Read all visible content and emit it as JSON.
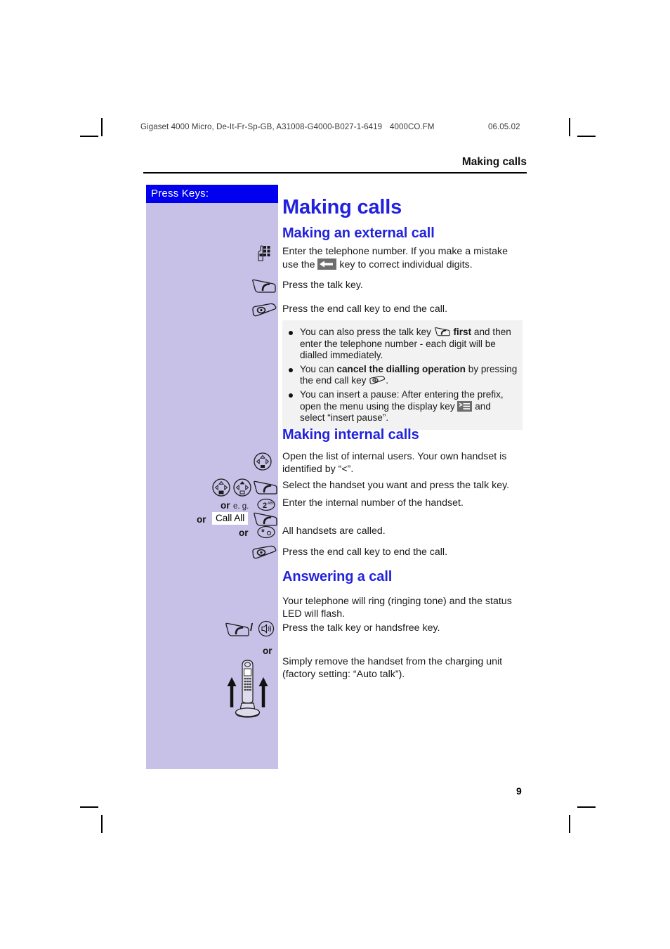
{
  "header": {
    "document_line": "Gigaset 4000 Micro, De-It-Fr-Sp-GB, A31008-G4000-B027-1-6419",
    "file_name": "4000CO.FM",
    "date": "06.05.02",
    "running_head": "Making calls"
  },
  "sidebar": {
    "title": "Press Keys:",
    "background_color": "#c7c1e7",
    "title_background_color": "#0000ee",
    "icons": [
      {
        "name": "keypad-key",
        "row": "enter-number"
      },
      {
        "name": "talk-key",
        "row": "press-talk"
      },
      {
        "name": "end-call-key",
        "row": "end-call"
      },
      {
        "name": "nav-key-down",
        "row": "open-internal-list"
      },
      {
        "name": "nav-key-select",
        "row": "select-handset"
      },
      {
        "name": "nav-key-up",
        "row": "select-handset"
      },
      {
        "name": "talk-key",
        "row": "select-handset"
      },
      {
        "name": "digit-key-2",
        "row": "enter-internal-number",
        "label": "2"
      },
      {
        "name": "call-all-display-key",
        "row": "call-all",
        "label": "Call All"
      },
      {
        "name": "talk-key",
        "row": "call-all"
      },
      {
        "name": "star-key",
        "row": "all-handsets-called"
      },
      {
        "name": "end-call-key",
        "row": "end-call-internal"
      },
      {
        "name": "talk-key",
        "row": "answer-call"
      },
      {
        "name": "handsfree-key",
        "row": "answer-call"
      },
      {
        "name": "handset-charging-unit",
        "row": "remove-handset"
      }
    ],
    "or_labels": [
      "or",
      "or",
      "or",
      "or"
    ],
    "eg_label": "e. g.",
    "call_all_label": "Call All",
    "separator_slash": "/"
  },
  "main": {
    "title": "Making calls",
    "accent_color": "#2222dd",
    "sections": [
      {
        "heading": "Making an external call",
        "steps": [
          {
            "icon": "keypad-key",
            "text_before": "Enter the telephone number. If you make a mistake use the ",
            "inline_icon": "correction-key",
            "text_after": " key to correct individual digits."
          },
          {
            "icon": "talk-key",
            "text": "Press the talk key."
          },
          {
            "icon": "end-call-key",
            "text": "Press the end call key to end the call."
          }
        ],
        "note_box": {
          "background_color": "#f2f2f2",
          "items": [
            {
              "parts": [
                {
                  "type": "text",
                  "value": "You can also press the talk key "
                },
                {
                  "type": "icon",
                  "value": "talk-key"
                },
                {
                  "type": "bold",
                  "value": " first"
                },
                {
                  "type": "text",
                  "value": " and then enter the telephone number - each digit will be dialled immediately."
                }
              ]
            },
            {
              "parts": [
                {
                  "type": "text",
                  "value": "You can "
                },
                {
                  "type": "bold",
                  "value": "cancel the dialling operation"
                },
                {
                  "type": "text",
                  "value": " by pressing the end call key "
                },
                {
                  "type": "icon",
                  "value": "end-call-key"
                },
                {
                  "type": "text",
                  "value": "."
                }
              ]
            },
            {
              "parts": [
                {
                  "type": "text",
                  "value": "You can insert a pause: After entering the prefix, open the menu using the display key "
                },
                {
                  "type": "icon",
                  "value": "display-key"
                },
                {
                  "type": "text",
                  "value": " and select “insert pause”."
                }
              ]
            }
          ]
        }
      },
      {
        "heading": "Making internal calls",
        "steps": [
          {
            "icon": "nav-key-down",
            "text": "Open the list of internal users. Your own handset is identified by “<”."
          },
          {
            "icon": "nav-keys-and-talk",
            "text": "Select the handset you want and press the talk key."
          },
          {
            "icon": "digit-key-2",
            "text": "Enter the internal number of the handset."
          },
          {
            "icon": "call-all-and-talk",
            "text": ""
          },
          {
            "icon": "star-key",
            "text": "All handsets are called."
          },
          {
            "icon": "end-call-key",
            "text": "Press the end call key to end the call."
          }
        ]
      },
      {
        "heading": "Answering a call",
        "steps": [
          {
            "icon": "",
            "text": "Your telephone will ring (ringing tone) and the status LED will flash."
          },
          {
            "icon": "talk-or-handsfree",
            "text": "Press the talk key or handsfree key."
          },
          {
            "icon": "handset-charging-unit",
            "text": "Simply remove the handset from the charging unit (factory setting: “Auto talk”)."
          }
        ]
      }
    ]
  },
  "footer": {
    "page_number": "9"
  }
}
